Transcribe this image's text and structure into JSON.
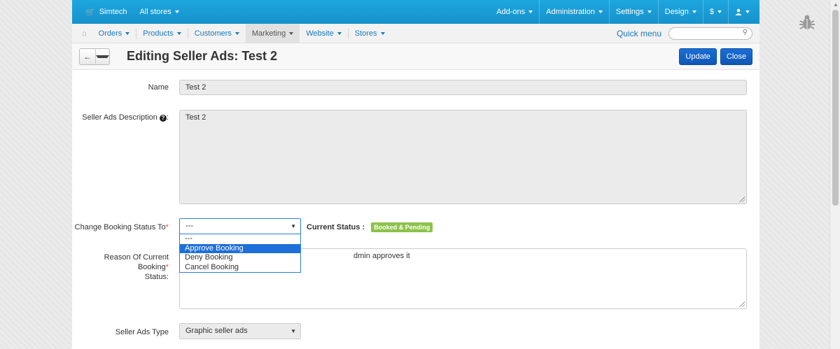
{
  "topbar": {
    "brand": "Simtech",
    "stores": "All stores",
    "right": [
      "Add-ons",
      "Administration",
      "Settings",
      "Design",
      "$",
      ""
    ]
  },
  "navbar": {
    "items": [
      "Orders",
      "Products",
      "Customers",
      "Marketing",
      "Website",
      "Stores"
    ],
    "active": "Marketing",
    "quick_menu": "Quick menu",
    "search_placeholder": ""
  },
  "titlebar": {
    "title": "Editing Seller Ads: Test 2",
    "update": "Update",
    "close": "Close"
  },
  "form": {
    "name_label": "Name",
    "name_value": "Test 2",
    "desc_label": "Seller Ads Description",
    "desc_suffix": ":",
    "desc_value": "Test 2",
    "status_label": "Change Booking Status To",
    "status_value": "---",
    "current_status_label": "Current Status :",
    "current_status_badge": "Booked & Pending",
    "status_options": [
      "---",
      "Approve Booking",
      "Deny Booking",
      "Cancel Booking"
    ],
    "status_highlighted": "Approve Booking",
    "reason_label_1": "Reason Of Current Booking",
    "reason_label_2": "Status:",
    "reason_value_visible": "dmin approves it",
    "type_label": "Seller Ads Type",
    "type_value": "Graphic seller ads"
  },
  "colors": {
    "topbar": "#1aa0d8",
    "primary_button": "#1a6ed6",
    "badge": "#8cc24a",
    "dropdown_highlight": "#1e6fd9"
  }
}
